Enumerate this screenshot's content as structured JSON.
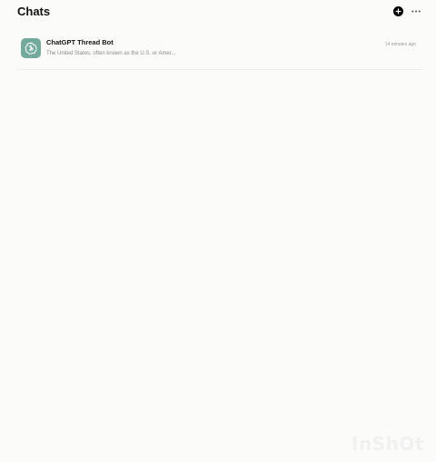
{
  "header": {
    "title": "Chats"
  },
  "icons": {
    "new_chat": "plus-icon",
    "more": "ellipsis-icon",
    "avatar": "openai-logo-icon"
  },
  "colors": {
    "avatar_background": "#74aa9c",
    "new_chat_button": "#000000"
  },
  "chats": [
    {
      "name": "ChatGPT Thread Bot",
      "preview": "The United States, often known as the U.S. or Amer...",
      "time": "14 minutes ago"
    }
  ],
  "watermark": "InShOt"
}
